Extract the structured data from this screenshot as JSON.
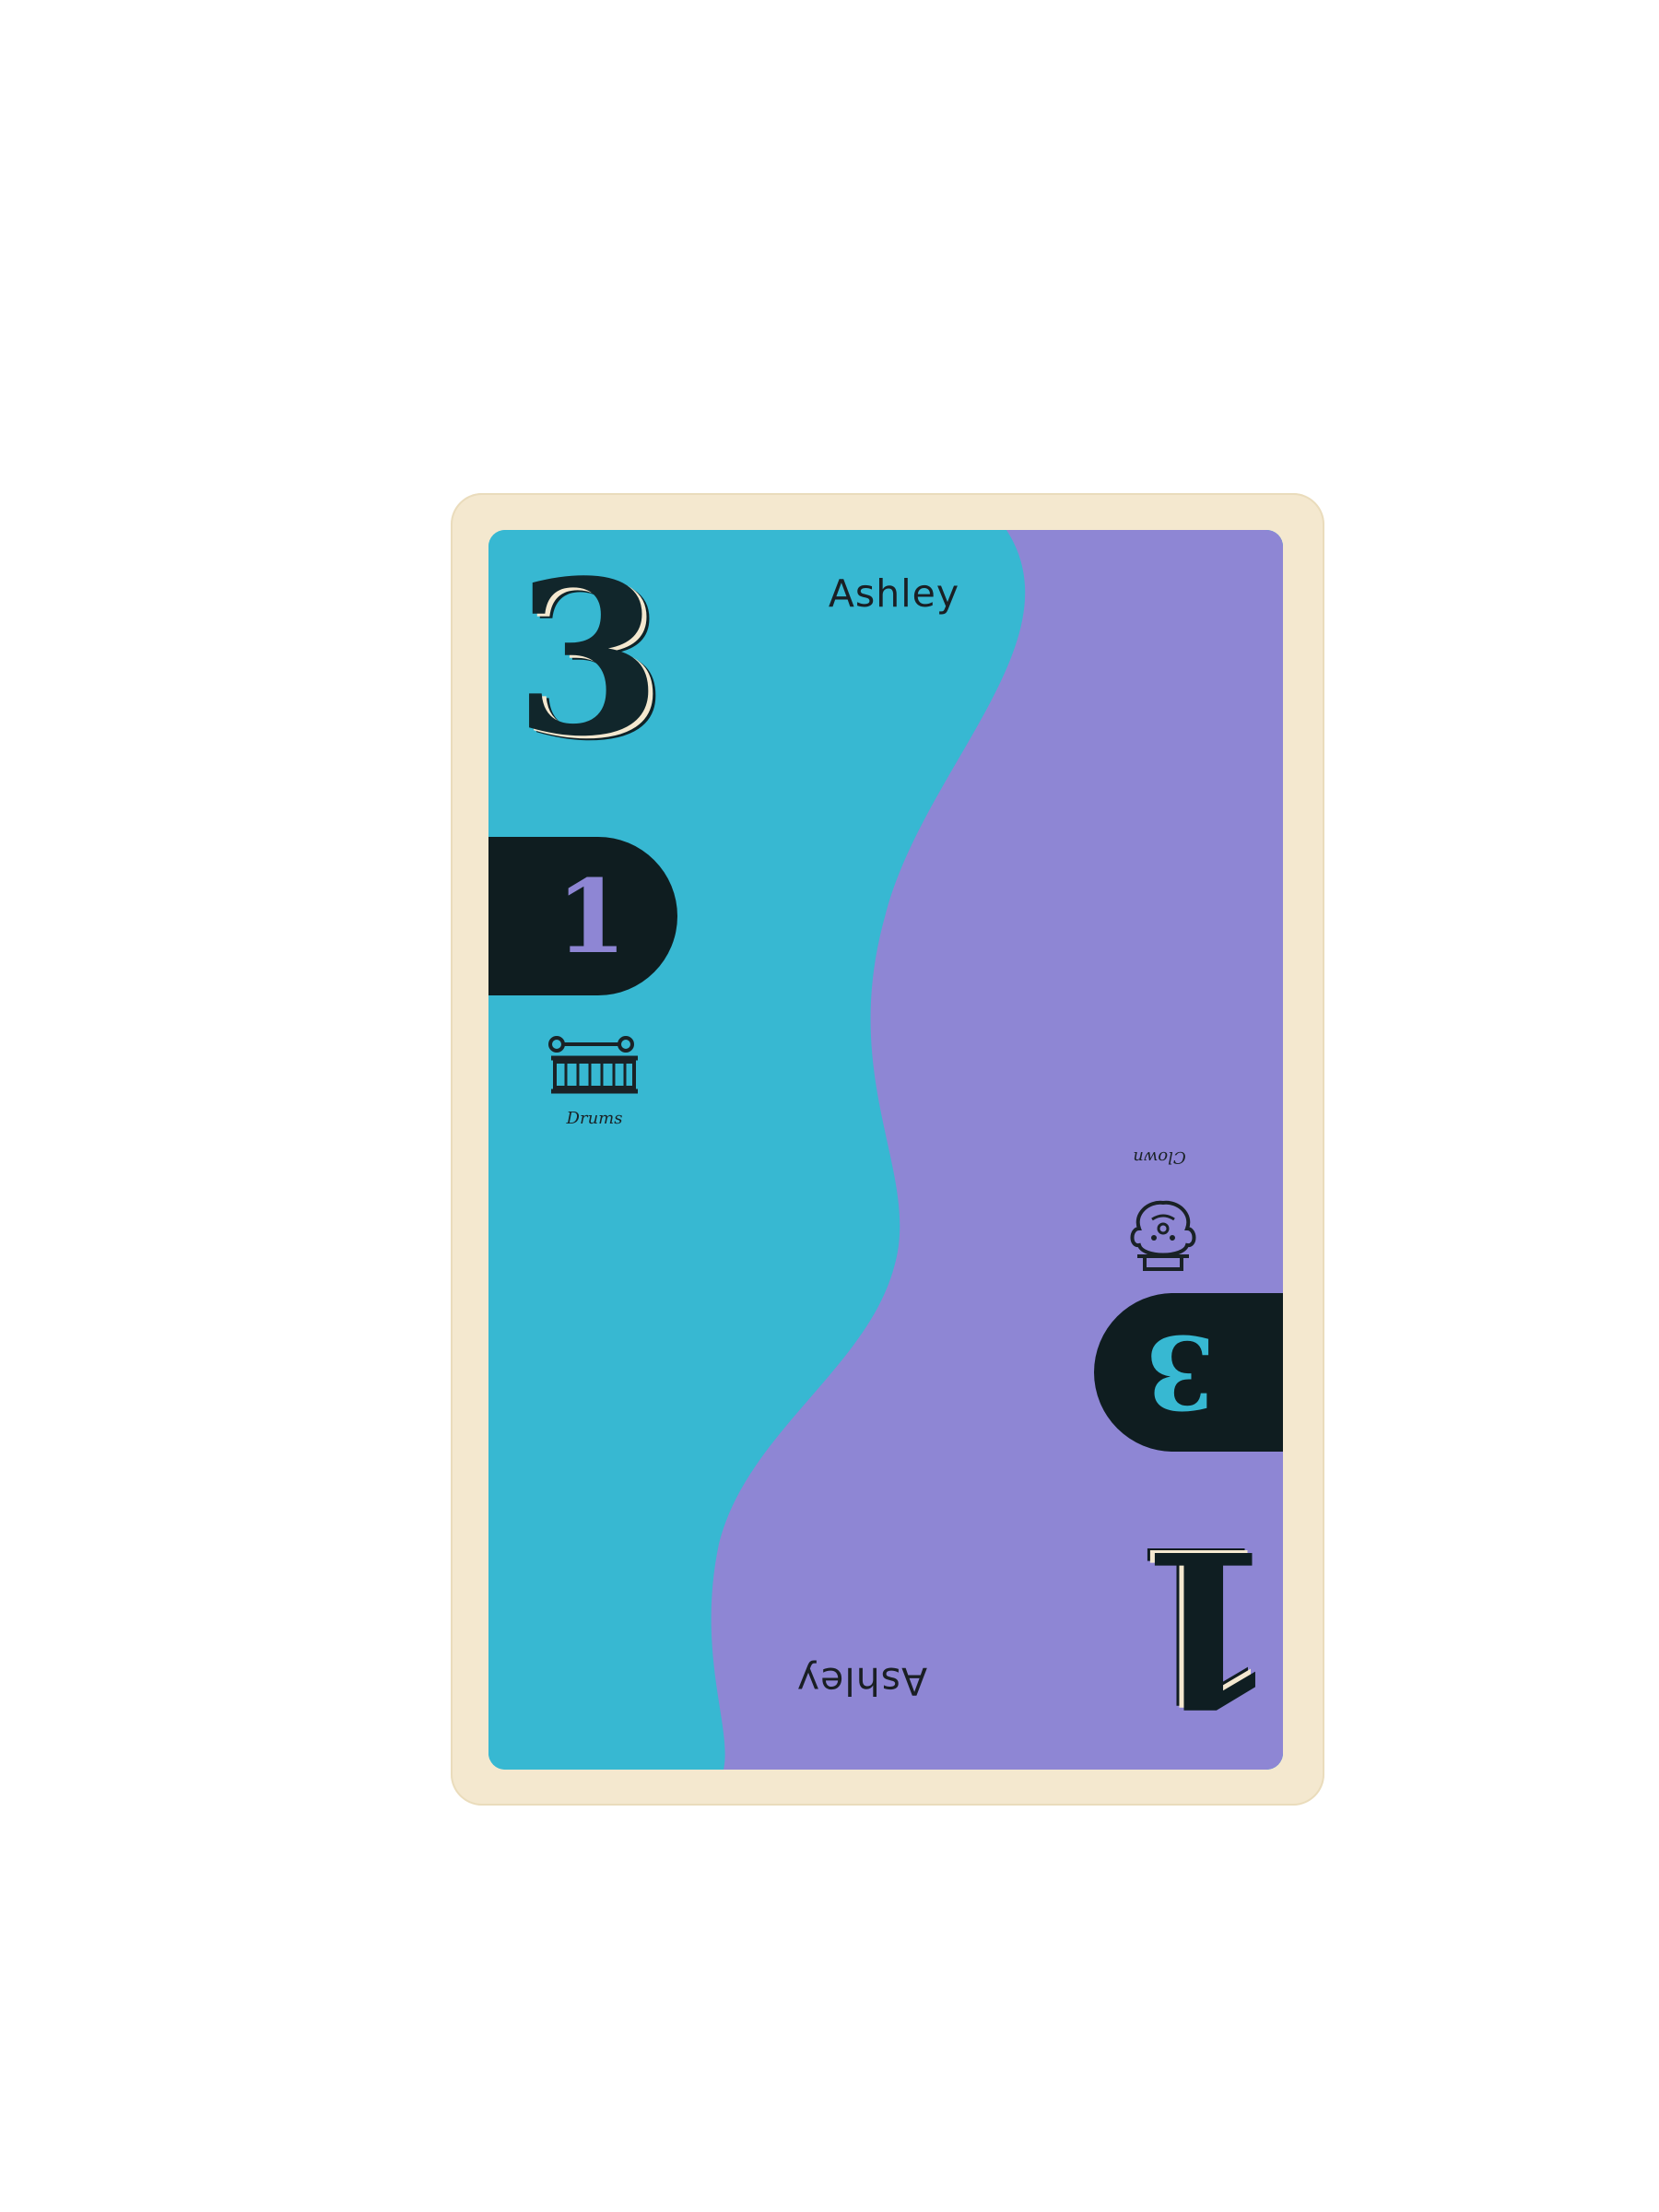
{
  "card": {
    "name_top": "Ashley",
    "name_bottom": "Ashley",
    "big_number_top": "3",
    "small_number_top": "1",
    "big_number_bottom": "1",
    "small_number_bottom": "3",
    "icon_top": {
      "icon": "drums-icon",
      "label": "Drums"
    },
    "icon_bottom": {
      "icon": "clown-icon",
      "label": "Clown"
    },
    "colors": {
      "left_half": "#37b8d2",
      "right_half": "#8e86d4",
      "border": "#f4e8cf",
      "ink": "#0f1d20"
    }
  }
}
